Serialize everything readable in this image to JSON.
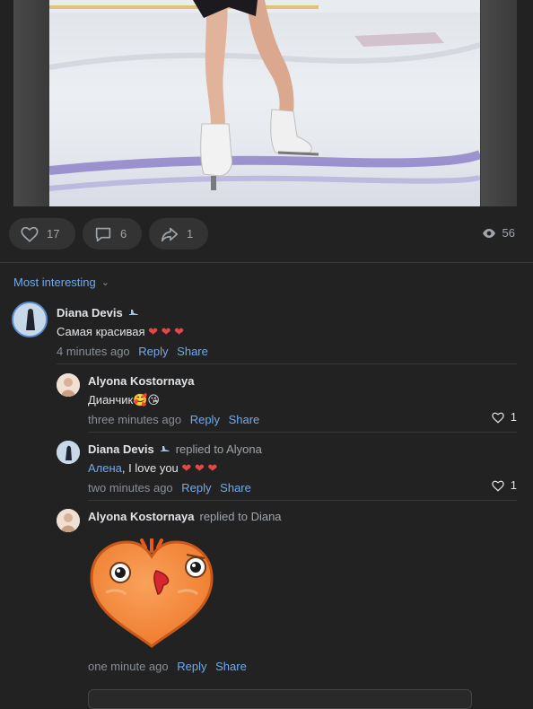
{
  "post": {
    "likes": "17",
    "comments": "6",
    "shares": "1",
    "views": "56"
  },
  "sort": {
    "label": "Most interesting"
  },
  "comments": [
    {
      "author": "Diana Devis",
      "text": "Самая красивая",
      "hearts": "❤ ❤ ❤",
      "time": "4 minutes ago",
      "reply": "Reply",
      "share": "Share"
    },
    {
      "author": "Alyona Kostornaya",
      "text": "Дианчик🥰😘",
      "time": "three minutes ago",
      "reply": "Reply",
      "share": "Share",
      "likes": "1"
    },
    {
      "author": "Diana Devis",
      "replied": "replied to Alyona",
      "mention": "Алена",
      "text": ", I love you",
      "hearts": "❤ ❤ ❤",
      "time": "two minutes ago",
      "reply": "Reply",
      "share": "Share",
      "likes": "1"
    },
    {
      "author": "Alyona Kostornaya",
      "replied": "replied to Diana",
      "time": "one minute ago",
      "reply": "Reply",
      "share": "Share"
    }
  ],
  "colors": {
    "background": "#222222",
    "accent": "#71aaeb",
    "heart": "#e64646",
    "sticker": "#f5883a"
  }
}
